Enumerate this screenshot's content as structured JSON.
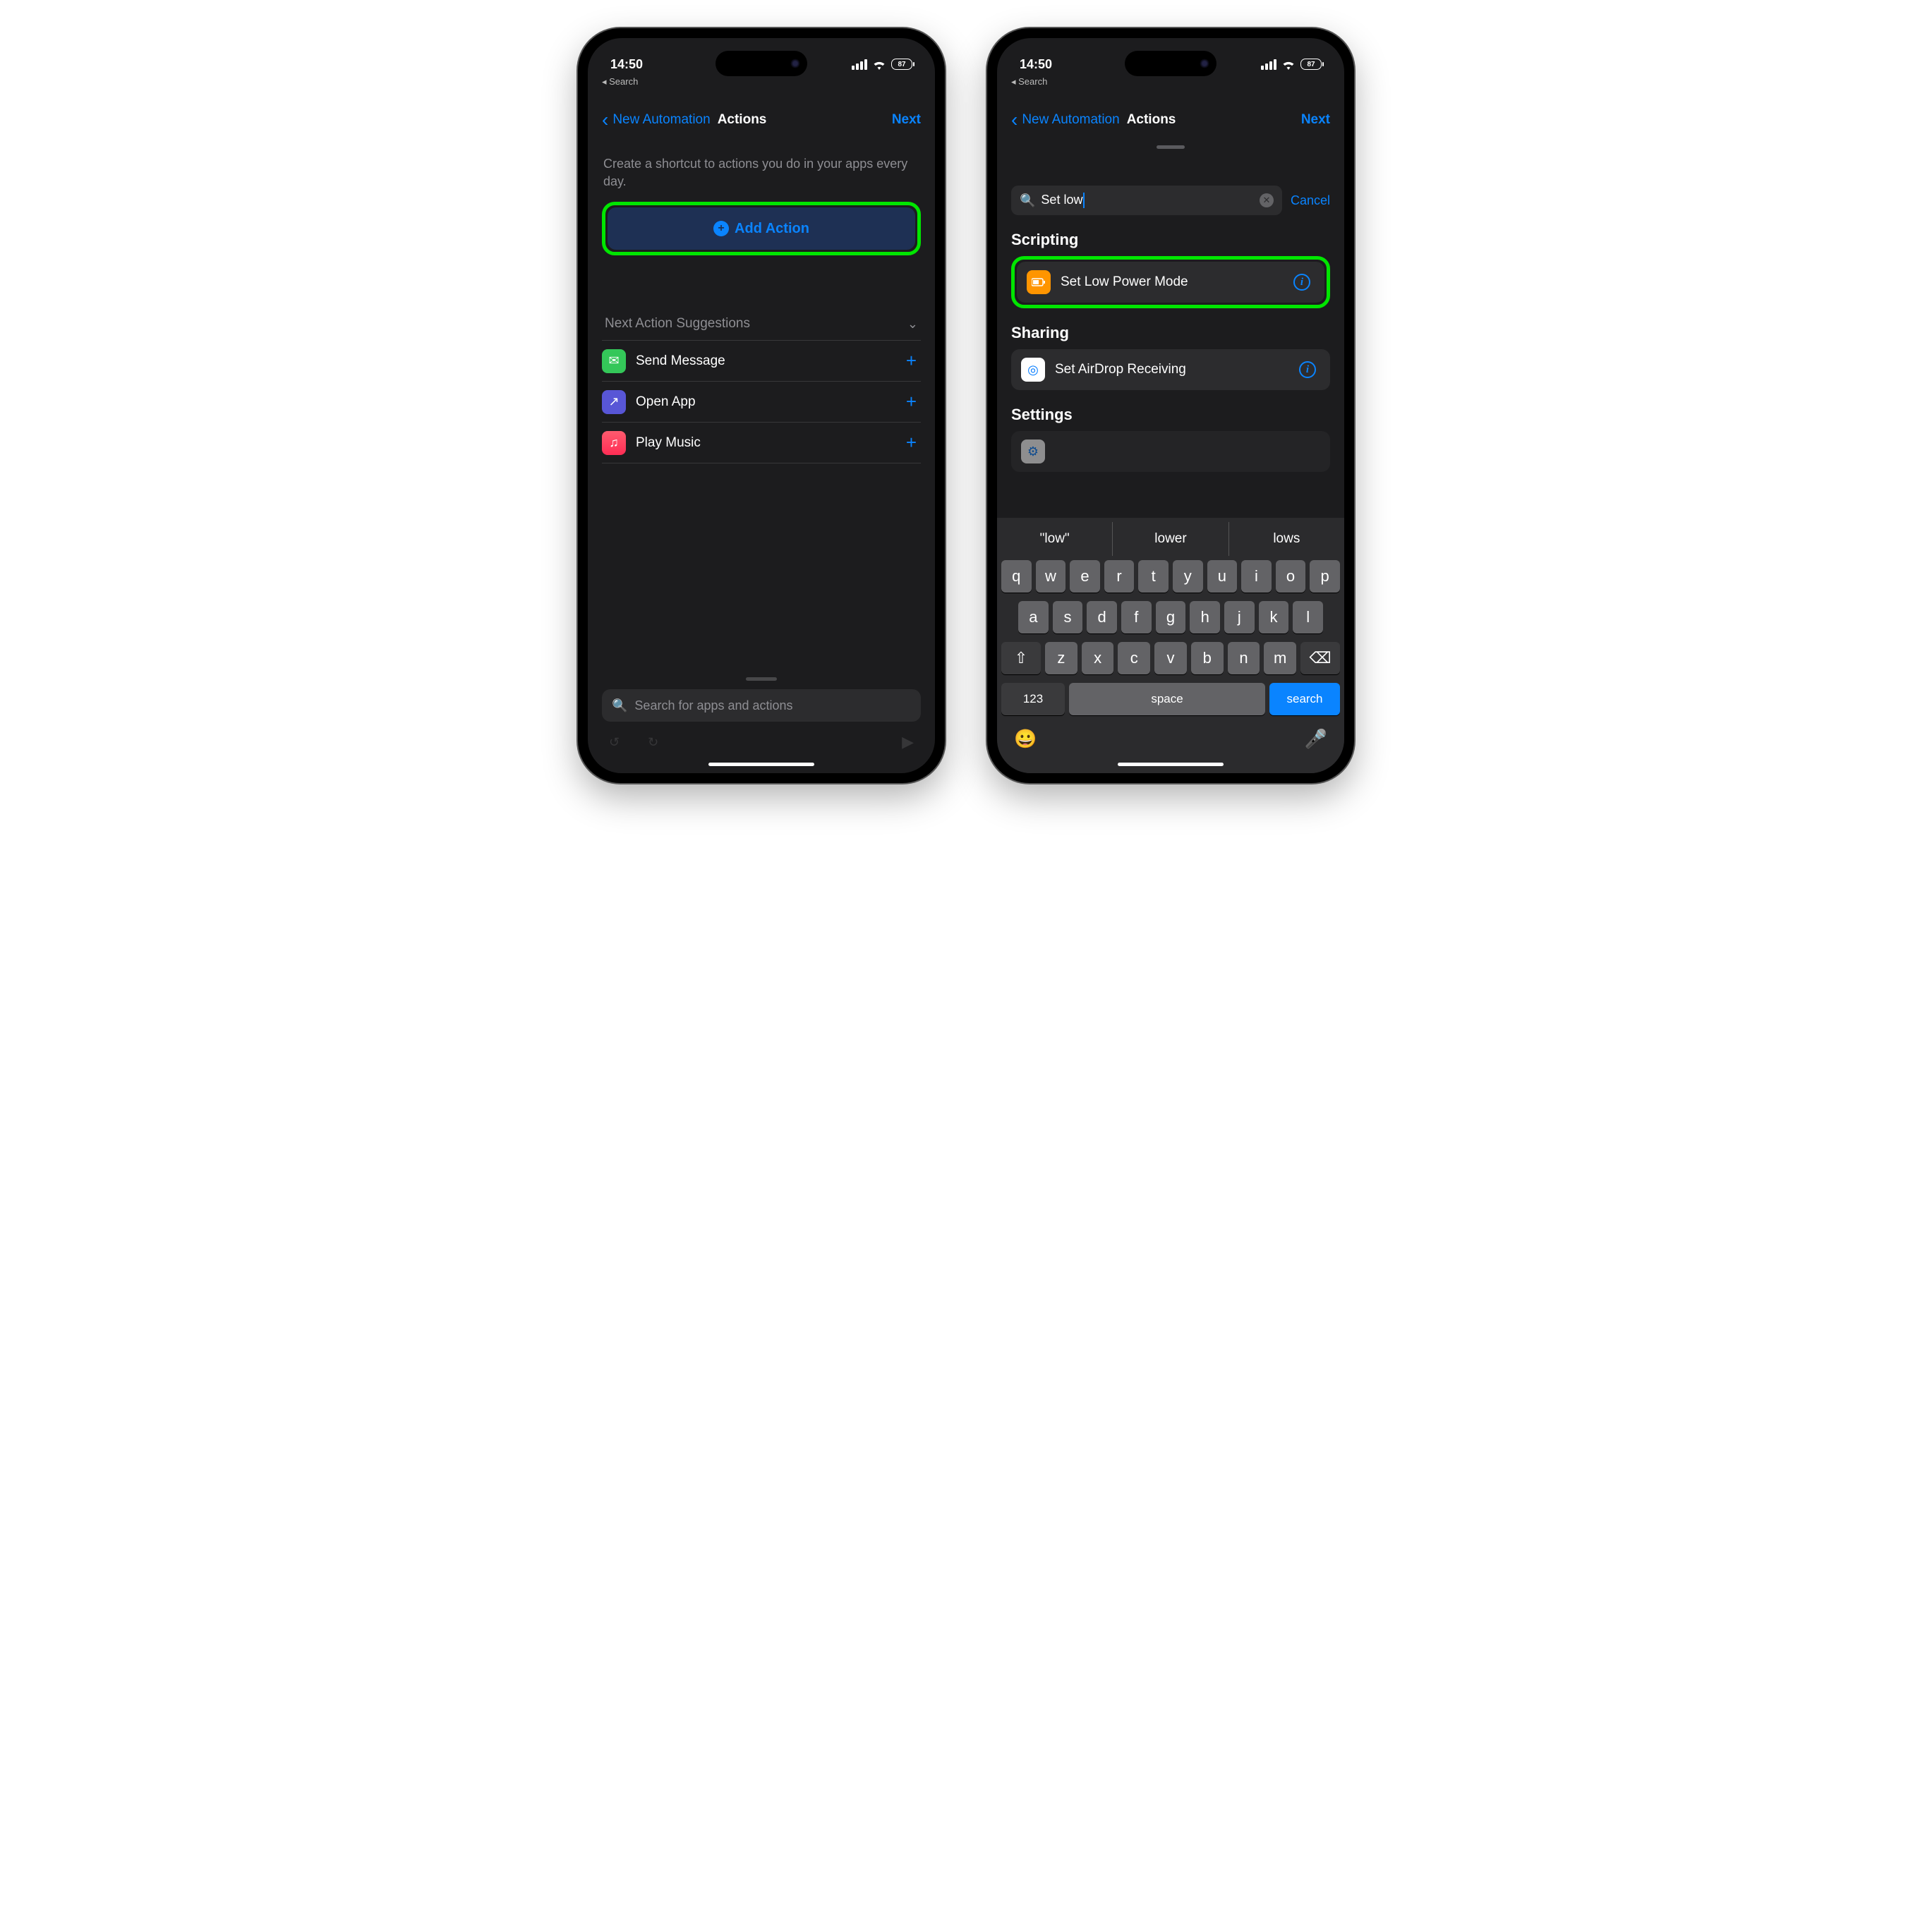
{
  "status": {
    "time": "14:50",
    "breadcrumb": "Search",
    "battery": "87"
  },
  "nav": {
    "back": "New Automation",
    "title": "Actions",
    "next": "Next"
  },
  "left": {
    "intro": "Create a shortcut to actions you do in your apps every day.",
    "add_action": "Add Action",
    "suggestions_header": "Next Action Suggestions",
    "suggestions": [
      {
        "label": "Send Message"
      },
      {
        "label": "Open App"
      },
      {
        "label": "Play Music"
      }
    ],
    "search_placeholder": "Search for apps and actions"
  },
  "right": {
    "search_value": "Set low",
    "cancel": "Cancel",
    "sections": {
      "scripting": "Scripting",
      "sharing": "Sharing",
      "settings": "Settings"
    },
    "results": {
      "low_power": "Set Low Power Mode",
      "airdrop": "Set AirDrop Receiving"
    },
    "predictions": [
      "\"low\"",
      "lower",
      "lows"
    ],
    "keyboard": {
      "row1": [
        "q",
        "w",
        "e",
        "r",
        "t",
        "y",
        "u",
        "i",
        "o",
        "p"
      ],
      "row2": [
        "a",
        "s",
        "d",
        "f",
        "g",
        "h",
        "j",
        "k",
        "l"
      ],
      "row3": [
        "z",
        "x",
        "c",
        "v",
        "b",
        "n",
        "m"
      ],
      "numbers": "123",
      "space": "space",
      "search": "search"
    }
  }
}
